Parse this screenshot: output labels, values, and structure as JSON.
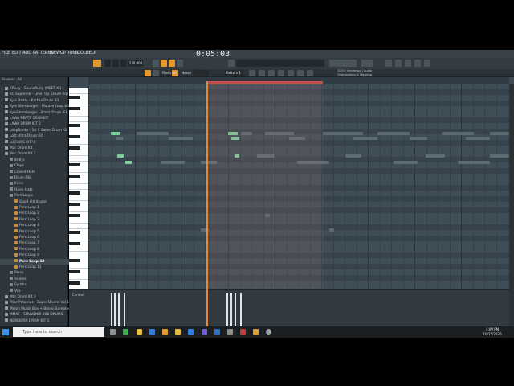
{
  "menu": [
    "FILE",
    "EDIT",
    "ADD",
    "PATTERNS",
    "VIEW",
    "OPTIONS",
    "TOOLS",
    "HELP"
  ],
  "transport": {
    "time": "0:05:03",
    "tempo": "130.000",
    "pattern": "Pattern 1"
  },
  "hint": {
    "line1": "10/15 Smokeroo | Audio",
    "line2": "Quantization & Warping"
  },
  "piano_roll": {
    "title": "Piano roll",
    "target": "Nexus"
  },
  "browser": {
    "header": "Browser - All",
    "path": "Drums Kit",
    "items": [
      {
        "label": "KRudy - SoundRudy (MEET KI)",
        "kind": "folder"
      },
      {
        "label": "KC Supreme - Level Up (Drum Kit)",
        "kind": "folder"
      },
      {
        "label": "Kyle Beats - Kartha Drum Kit",
        "kind": "folder"
      },
      {
        "label": "Kyle Stemberger - Mojave Loop Kit",
        "kind": "folder"
      },
      {
        "label": "KyleStemberger - Static Drum Kit",
        "kind": "folder"
      },
      {
        "label": "LAWA BEATS DRUMKIT",
        "kind": "folder"
      },
      {
        "label": "LAWA DRUM KIT 2",
        "kind": "folder"
      },
      {
        "label": "LoopBanks - 10 ft Saber Drum Kit",
        "kind": "folder"
      },
      {
        "label": "Lost Ultra Drum Kit",
        "kind": "folder"
      },
      {
        "label": "LUCHIOS KIT VI",
        "kind": "folder"
      },
      {
        "label": "Mar Drum Kit",
        "kind": "folder"
      },
      {
        "label": "Mar Drum Kit 2",
        "kind": "folder-open"
      },
      {
        "label": "808_s",
        "kind": "sub"
      },
      {
        "label": "Claps",
        "kind": "sub"
      },
      {
        "label": "Closed Hats",
        "kind": "sub"
      },
      {
        "label": "Drum Fills",
        "kind": "sub"
      },
      {
        "label": "Kicks",
        "kind": "sub"
      },
      {
        "label": "Open Hats",
        "kind": "sub"
      },
      {
        "label": "Perc Loops",
        "kind": "sub-open"
      },
      {
        "label": "Good old drums",
        "kind": "file"
      },
      {
        "label": "Perc Loop 1",
        "kind": "file"
      },
      {
        "label": "Perc Loop 2",
        "kind": "file"
      },
      {
        "label": "Perc Loop 3",
        "kind": "file"
      },
      {
        "label": "Perc Loop 4",
        "kind": "file"
      },
      {
        "label": "Perc Loop 5",
        "kind": "file"
      },
      {
        "label": "Perc Loop 6",
        "kind": "file"
      },
      {
        "label": "Perc Loop 7",
        "kind": "file"
      },
      {
        "label": "Perc Loop 8",
        "kind": "file"
      },
      {
        "label": "Perc Loop 9",
        "kind": "file"
      },
      {
        "label": "Perc Loop 10",
        "kind": "file-selected"
      },
      {
        "label": "Perc Loop 11",
        "kind": "file"
      },
      {
        "label": "Percs",
        "kind": "sub"
      },
      {
        "label": "Snares",
        "kind": "sub"
      },
      {
        "label": "Synths",
        "kind": "sub"
      },
      {
        "label": "Vox",
        "kind": "sub"
      },
      {
        "label": "Mar Drum Kit 3",
        "kind": "folder"
      },
      {
        "label": "Mike Potomac - Super Drums Vol 1",
        "kind": "folder"
      },
      {
        "label": "Melon Musik Box + Bones Samples",
        "kind": "folder"
      },
      {
        "label": "MMXF - SOUVENIR 808 DRUMS",
        "kind": "folder"
      },
      {
        "label": "NEWBORN DRUM KIT 1",
        "kind": "folder"
      }
    ]
  },
  "control": {
    "label": "Control"
  },
  "taskbar": {
    "search_placeholder": "Type here to search",
    "time": "4:09 PM",
    "date": "10/15/2020"
  },
  "colors": {
    "accent": "#e09a30",
    "note": "#7fcf9b",
    "loop": "#c0504d",
    "playhead": "#e08a3a"
  }
}
